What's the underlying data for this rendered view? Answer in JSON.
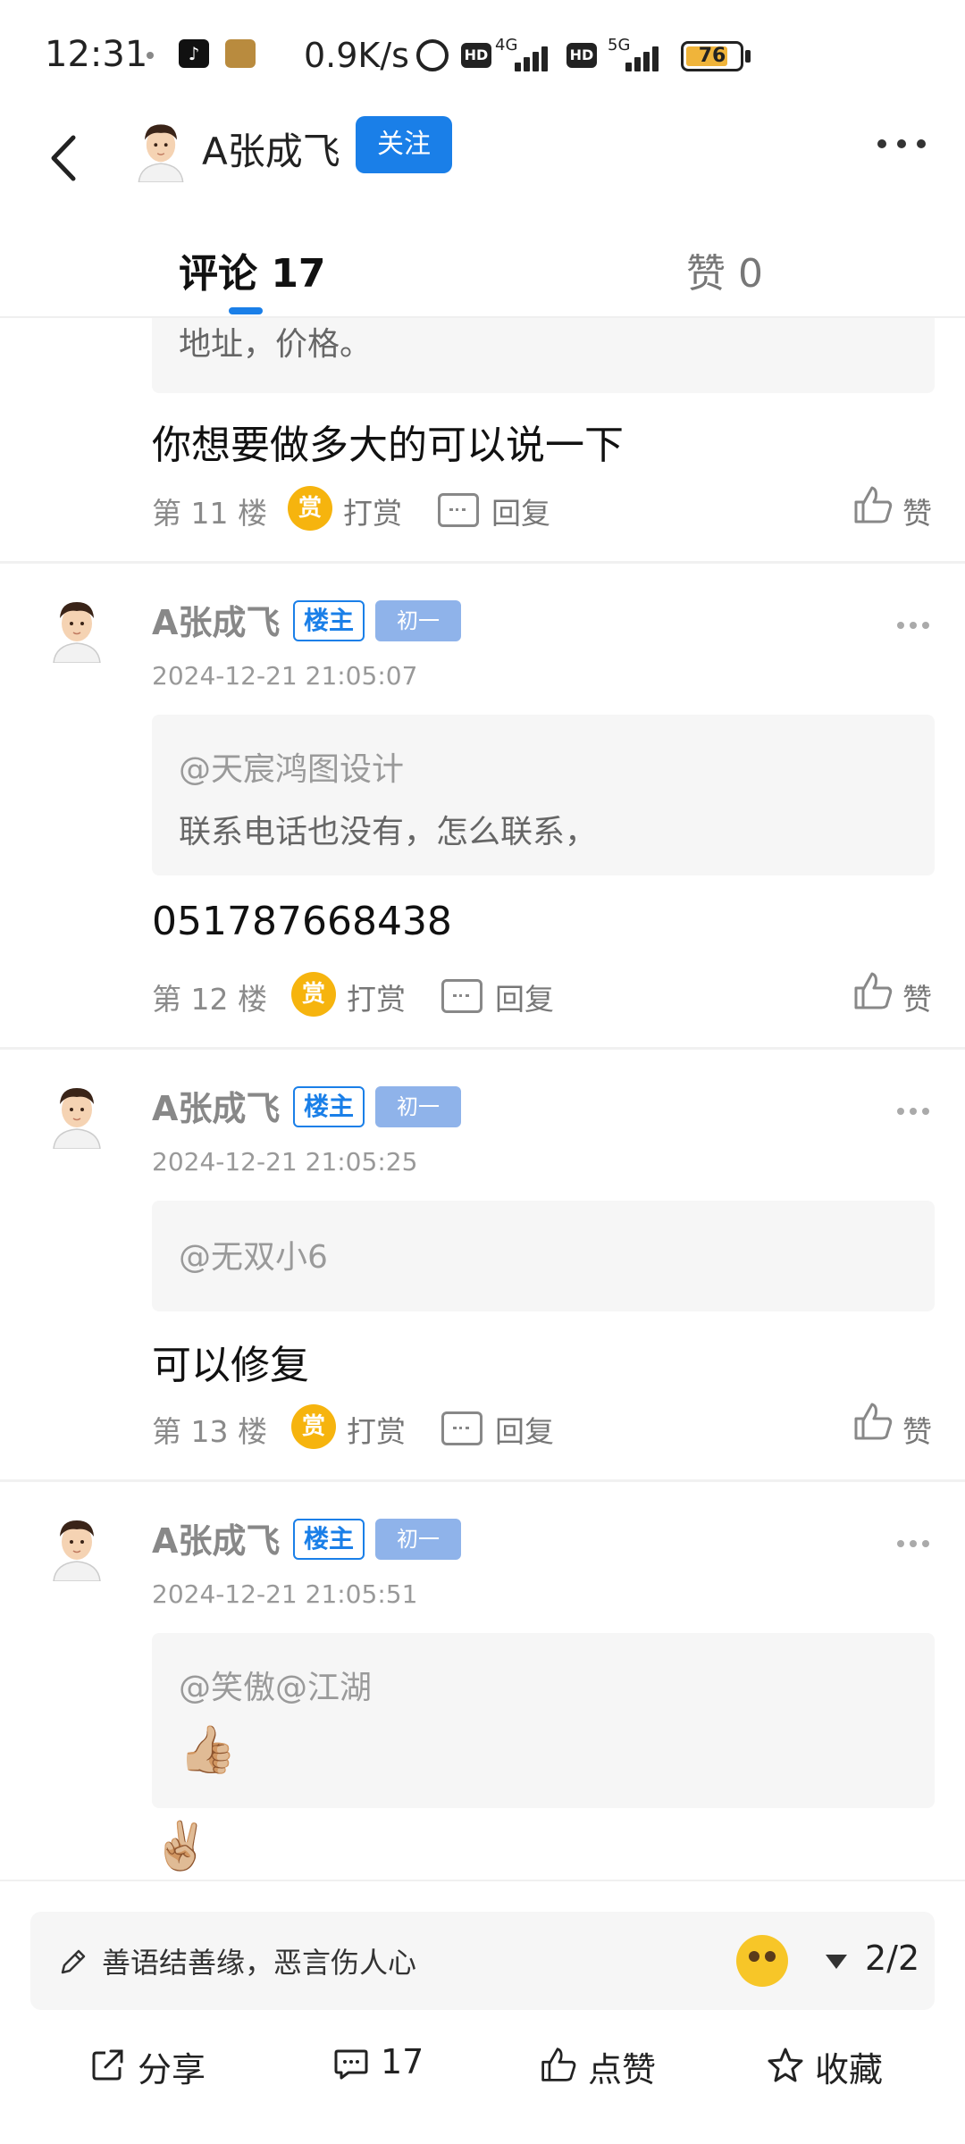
{
  "status_bar": {
    "time": "12:31",
    "speed": "0.9K/s",
    "hd1": "HD",
    "net1": "4G",
    "hd2": "HD",
    "net2": "5G",
    "battery": "76"
  },
  "header": {
    "author_name": "A张成飞",
    "follow_label": "关注"
  },
  "tabs": {
    "comments_label": "评论 17",
    "likes_label": "赞 0"
  },
  "comments": [
    {
      "quote_text": "地址，价格。",
      "text": "你想要做多大的可以说一下",
      "floor": "第 11 楼",
      "reward_label": "打赏",
      "reply_label": "回复",
      "like_label": "赞"
    },
    {
      "name": "A张成飞",
      "owner_badge": "楼主",
      "level_badge": "初一",
      "time": "2024-12-21 21:05:07",
      "quote_user": "@天宸鸿图设计",
      "quote_text": "联系电话也没有，怎么联系，",
      "text": "051787668438",
      "floor": "第 12 楼",
      "reward_label": "打赏",
      "reply_label": "回复",
      "like_label": "赞"
    },
    {
      "name": "A张成飞",
      "owner_badge": "楼主",
      "level_badge": "初一",
      "time": "2024-12-21 21:05:25",
      "quote_user": "@无双小6",
      "text": "可以修复",
      "floor": "第 13 楼",
      "reward_label": "打赏",
      "reply_label": "回复",
      "like_label": "赞"
    },
    {
      "name": "A张成飞",
      "owner_badge": "楼主",
      "level_badge": "初一",
      "time": "2024-12-21 21:05:51",
      "quote_user": "@笑傲@江湖",
      "quote_text": "👍🏼",
      "text": "✌🏼"
    }
  ],
  "reward_glyph": "赏",
  "bottom_bar": {
    "input_placeholder": "善语结善缘，恶言伤人心",
    "page_indicator": "2/2",
    "share_label": "分享",
    "comment_count": "17",
    "like_label": "点赞",
    "favorite_label": "收藏"
  },
  "colors": {
    "accent": "#1a7fe8",
    "reward": "#f6b40e",
    "level_badge": "#8fb3ea"
  }
}
